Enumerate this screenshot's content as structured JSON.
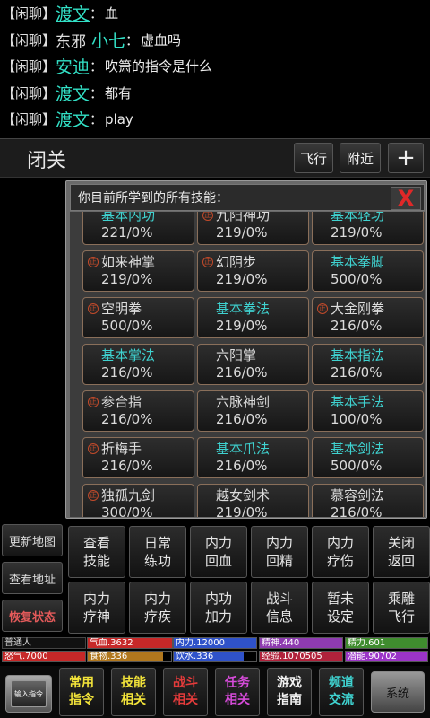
{
  "chat": [
    {
      "channel": "【闲聊】",
      "prefix": "",
      "name": "渡文",
      "text": "血"
    },
    {
      "channel": "【闲聊】",
      "prefix": "东邪",
      "name": "小七",
      "text": "虚血吗"
    },
    {
      "channel": "【闲聊】",
      "prefix": "",
      "name": "安迪",
      "text": "吹箫的指令是什么"
    },
    {
      "channel": "【闲聊】",
      "prefix": "",
      "name": "渡文",
      "text": "都有"
    },
    {
      "channel": "【闲聊】",
      "prefix": "",
      "name": "渡文",
      "text": "play"
    }
  ],
  "chat_sep": "：",
  "room": {
    "title": "闭关",
    "fly": "飞行",
    "nearby": "附近",
    "plus": "+"
  },
  "panel": {
    "title": "你目前所学到的所有技能：",
    "close": "X"
  },
  "skills": [
    {
      "name": "基本内功",
      "value": "221/0%",
      "basic": true,
      "mark": false
    },
    {
      "name": "九阳神功",
      "value": "219/0%",
      "basic": false,
      "mark": true
    },
    {
      "name": "基本轻功",
      "value": "219/0%",
      "basic": true,
      "mark": false
    },
    {
      "name": "如来神掌",
      "value": "219/0%",
      "basic": false,
      "mark": true
    },
    {
      "name": "幻阴步",
      "value": "219/0%",
      "basic": false,
      "mark": true
    },
    {
      "name": "基本拳脚",
      "value": "500/0%",
      "basic": true,
      "mark": false
    },
    {
      "name": "空明拳",
      "value": "500/0%",
      "basic": false,
      "mark": true
    },
    {
      "name": "基本拳法",
      "value": "219/0%",
      "basic": true,
      "mark": false
    },
    {
      "name": "大金刚拳",
      "value": "216/0%",
      "basic": false,
      "mark": true
    },
    {
      "name": "基本掌法",
      "value": "216/0%",
      "basic": true,
      "mark": false
    },
    {
      "name": "六阳掌",
      "value": "216/0%",
      "basic": false,
      "mark": false
    },
    {
      "name": "基本指法",
      "value": "216/0%",
      "basic": true,
      "mark": false
    },
    {
      "name": "参合指",
      "value": "216/0%",
      "basic": false,
      "mark": true
    },
    {
      "name": "六脉神剑",
      "value": "216/0%",
      "basic": false,
      "mark": false
    },
    {
      "name": "基本手法",
      "value": "100/0%",
      "basic": true,
      "mark": false
    },
    {
      "name": "折梅手",
      "value": "216/0%",
      "basic": false,
      "mark": true
    },
    {
      "name": "基本爪法",
      "value": "216/0%",
      "basic": true,
      "mark": false
    },
    {
      "name": "基本剑法",
      "value": "500/0%",
      "basic": true,
      "mark": false
    },
    {
      "name": "独孤九剑",
      "value": "300/0%",
      "basic": false,
      "mark": true
    },
    {
      "name": "越女剑术",
      "value": "219/0%",
      "basic": false,
      "mark": false
    },
    {
      "name": "慕容剑法",
      "value": "216/0%",
      "basic": false,
      "mark": false
    }
  ],
  "mark_char": "正",
  "left_buttons": [
    {
      "label": "更新地图",
      "red": false
    },
    {
      "label": "查看地址",
      "red": false
    },
    {
      "label": "恢复状态",
      "red": true
    }
  ],
  "actions": [
    [
      "查看",
      "技能"
    ],
    [
      "日常",
      "练功"
    ],
    [
      "内力",
      "回血"
    ],
    [
      "内力",
      "回精"
    ],
    [
      "内力",
      "疗伤"
    ],
    [
      "关闭",
      "返回"
    ],
    [
      "内力",
      "疗神"
    ],
    [
      "内力",
      "疗疾"
    ],
    [
      "内功",
      "加力"
    ],
    [
      "战斗",
      "信息"
    ],
    [
      "暂未",
      "设定"
    ],
    [
      "乘雕",
      "飞行"
    ]
  ],
  "status": {
    "rank": "普通人",
    "stats": [
      {
        "label": "气血.3632",
        "color": "#c62828",
        "fill": 1.0
      },
      {
        "label": "内力.12000",
        "color": "#2f52c9",
        "fill": 1.0
      },
      {
        "label": "精神.440",
        "color": "#8e3bb0",
        "fill": 1.0
      },
      {
        "label": "精力.601",
        "color": "#3f8c2e",
        "fill": 1.0
      },
      {
        "label": "怒气.7000",
        "color": "#c62828",
        "fill": 1.0
      },
      {
        "label": "食物.336",
        "color": "#b1771d",
        "fill": 0.9
      },
      {
        "label": "饮水.336",
        "color": "#2f52c9",
        "fill": 0.85
      },
      {
        "label": "经验.1070505",
        "color": "#b0223b",
        "fill": 1.0
      },
      {
        "label": "潜能.90702",
        "color": "#9b34c7",
        "fill": 1.0
      }
    ]
  },
  "nav": {
    "input_label": "输入指令",
    "buttons": [
      {
        "line1": "常用",
        "line2": "指令",
        "color": "#f2e33a"
      },
      {
        "line1": "技能",
        "line2": "相关",
        "color": "#f2e33a"
      },
      {
        "line1": "战斗",
        "line2": "相关",
        "color": "#e43b3b"
      },
      {
        "line1": "任务",
        "line2": "相关",
        "color": "#d64bd9"
      },
      {
        "line1": "游戏",
        "line2": "指南",
        "color": "#f2f2f2"
      },
      {
        "line1": "频道",
        "line2": "交流",
        "color": "#3fd2d0"
      }
    ],
    "system": "系统"
  }
}
